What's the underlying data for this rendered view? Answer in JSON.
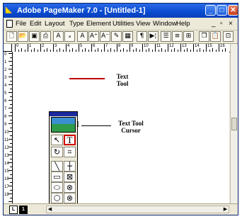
{
  "window": {
    "title": "Adobe PageMaker 7.0 - [Untitled-1]",
    "controls": {
      "minimize": "_",
      "maximize": "□",
      "close": "✕"
    },
    "colors": {
      "titlebar": "#0a4bd0",
      "close": "#c6401f",
      "highlight": "#d00000"
    }
  },
  "menubar": {
    "items": [
      {
        "label": "File",
        "icon": "document-icon"
      },
      {
        "label": "Edit"
      },
      {
        "label": "Layout"
      },
      {
        "label": "Type"
      },
      {
        "label": "Element"
      },
      {
        "label": "Utilities"
      },
      {
        "label": "View"
      },
      {
        "label": "Window"
      },
      {
        "label": "Help"
      }
    ],
    "doc_controls": {
      "minimize": "_",
      "restore": "▫",
      "close": "×"
    }
  },
  "toolbar": {
    "buttons": [
      {
        "name": "new-icon",
        "glyph": "🗋"
      },
      {
        "name": "open-icon",
        "glyph": "📂"
      },
      {
        "name": "save-icon",
        "glyph": "▣"
      },
      {
        "name": "print-icon",
        "glyph": "⎙"
      },
      {
        "name": "find-icon",
        "glyph": "A"
      },
      {
        "name": "spelling-icon",
        "glyph": "ₐ"
      },
      {
        "name": "bold-a-icon",
        "glyph": "A"
      },
      {
        "name": "increase-size-icon",
        "glyph": "A⁺"
      },
      {
        "name": "decrease-size-icon",
        "glyph": "A⁻"
      },
      {
        "name": "style-icon",
        "glyph": "✎"
      },
      {
        "name": "box-icon",
        "glyph": "▦"
      },
      {
        "name": "paragraph-icon",
        "glyph": "¶"
      },
      {
        "name": "indent-icon",
        "glyph": "▶¦"
      },
      {
        "name": "bullets-icon",
        "glyph": "☰"
      },
      {
        "name": "align-icon",
        "glyph": "≡"
      },
      {
        "name": "columns-icon",
        "glyph": "⊞"
      },
      {
        "name": "copy-icon",
        "glyph": "❐"
      },
      {
        "name": "paste-icon",
        "glyph": "📋"
      },
      {
        "name": "zoom-icon",
        "glyph": "⊡"
      }
    ]
  },
  "ruler": {
    "horizontal": [
      "0",
      "1",
      "2",
      "3",
      "4",
      "5",
      "6",
      "7",
      "8",
      "9",
      "10",
      "11",
      "12",
      "13",
      "14",
      "15",
      "16"
    ],
    "vertical": [
      "0",
      "1",
      "2",
      "3",
      "4",
      "5",
      "6",
      "7",
      "8",
      "9",
      "10",
      "11",
      "12",
      "13",
      "14",
      "15",
      "16",
      "17",
      "18",
      "19",
      "20"
    ]
  },
  "toolbox": {
    "tools": [
      {
        "name": "pointer-tool",
        "glyph": "↖"
      },
      {
        "name": "text-tool",
        "glyph": "T",
        "highlighted": true
      },
      {
        "name": "rotate-tool",
        "glyph": "↻"
      },
      {
        "name": "crop-tool",
        "glyph": "⌗"
      },
      {
        "name": "line-tool",
        "glyph": "╲"
      },
      {
        "name": "constrained-line-tool",
        "glyph": "┼"
      },
      {
        "name": "rectangle-tool",
        "glyph": "▭"
      },
      {
        "name": "rectangle-frame-tool",
        "glyph": "⊠"
      },
      {
        "name": "ellipse-tool",
        "glyph": "⬭"
      },
      {
        "name": "ellipse-frame-tool",
        "glyph": "⊗"
      },
      {
        "name": "polygon-tool",
        "glyph": "⬡"
      },
      {
        "name": "polygon-frame-tool",
        "glyph": "⊗"
      },
      {
        "name": "hand-tool",
        "glyph": "✋"
      },
      {
        "name": "zoom-tool",
        "glyph": "🔍"
      }
    ]
  },
  "annotations": {
    "text_tool": [
      "Text",
      "Tool"
    ],
    "cursor": [
      "Text Tool",
      "Cursor"
    ],
    "cursor_glyph": "I"
  },
  "status": {
    "page_left": "L",
    "page_right": "1"
  }
}
